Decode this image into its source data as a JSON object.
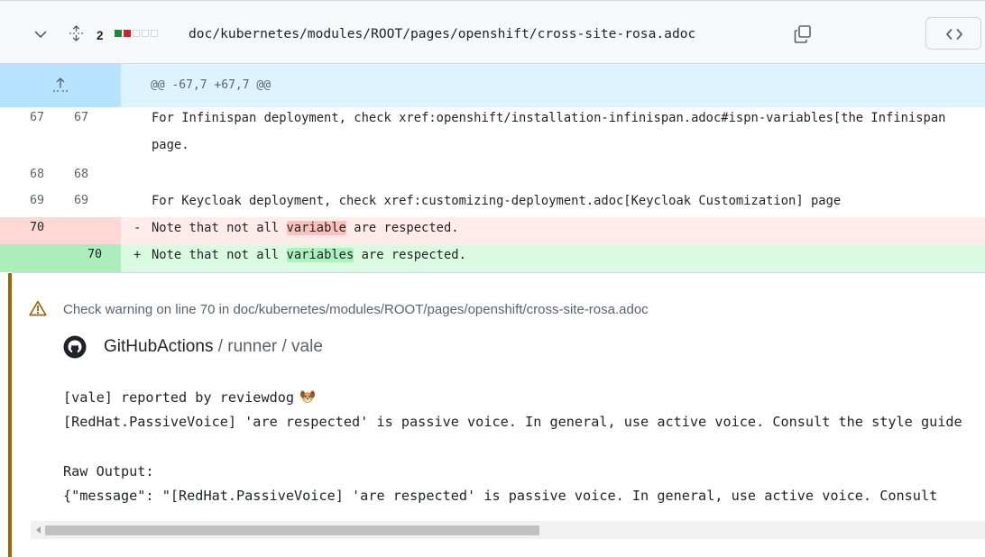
{
  "file_header": {
    "changes_count": "2",
    "diffstat": [
      "green",
      "red",
      "grey",
      "grey",
      "grey"
    ],
    "file_path": "doc/kubernetes/modules/ROOT/pages/openshift/cross-site-rosa.adoc",
    "icons": [
      "chevron-down-icon",
      "unfold-icon",
      "copy-icon",
      "code-icon"
    ]
  },
  "hunk": {
    "header": "@@ -67,7 +67,7 @@",
    "expand_icon": "expand-up-icon"
  },
  "lines": [
    {
      "old": "67",
      "new": "67",
      "text": "For Infinispan deployment, check xref:openshift/installation-infinispan.adoc#ispn-variables[the Infinispan",
      "type": "context"
    },
    {
      "old": "",
      "new": "",
      "text": "page.",
      "type": "context-wrap"
    },
    {
      "old": "68",
      "new": "68",
      "text": "",
      "type": "context"
    },
    {
      "old": "69",
      "new": "69",
      "text": "For Keycloak deployment, check xref:customizing-deployment.adoc[Keycloak Customization] page",
      "type": "context"
    },
    {
      "old": "70",
      "new": "",
      "marker": "-",
      "before": "Note that not all ",
      "highlight": "variable",
      "after": " are respected.",
      "type": "deletion"
    },
    {
      "old": "",
      "new": "70",
      "marker": "+",
      "before": "Note that not all ",
      "highlight": "variables",
      "after": " are respected.",
      "type": "addition"
    }
  ],
  "comment": {
    "warning_text": "Check warning on line 70 in doc/kubernetes/modules/ROOT/pages/openshift/cross-site-rosa.adoc",
    "author": "GitHubActions",
    "path_rest": " / runner / vale",
    "reported_by": "[vale] reported by reviewdog",
    "message": "[RedHat.PassiveVoice] 'are respected' is passive voice. In general, use active voice. Consult the style guide",
    "raw_label": "Raw Output:",
    "raw_output": "{\"message\": \"[RedHat.PassiveVoice] 'are respected' is passive voice. In general, use active voice. Consult",
    "accent_color": "#9a6700"
  },
  "scrollbar": {
    "position_fraction": 0.52
  },
  "colors": {
    "deletion_bg": "#ffebe9",
    "deletion_highlight": "#ffc0ba",
    "addition_bg": "#dafbe1",
    "addition_highlight": "#abf2bc",
    "hunk_bg": "#ddf4ff"
  }
}
